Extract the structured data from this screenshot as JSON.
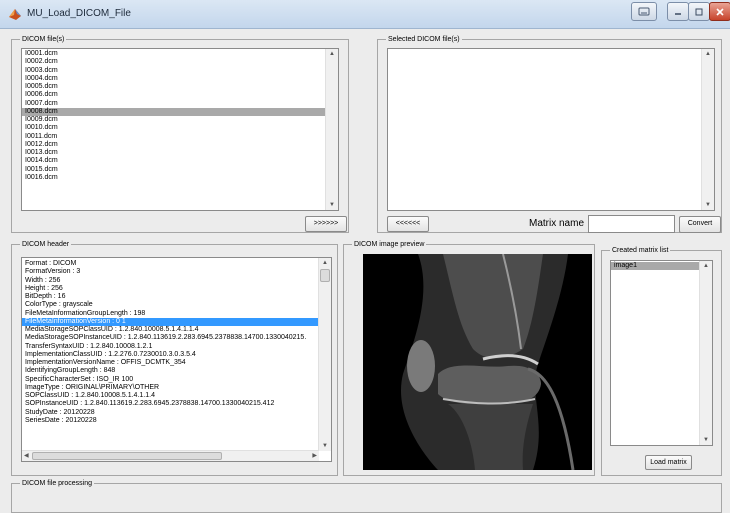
{
  "window": {
    "title": "MU_Load_DICOM_File"
  },
  "dicom_files": {
    "title": "DICOM file(s)",
    "items": [
      "I0001.dcm",
      "I0002.dcm",
      "I0003.dcm",
      "I0004.dcm",
      "I0005.dcm",
      "I0006.dcm",
      "I0007.dcm",
      "I0008.dcm",
      "I0009.dcm",
      "I0010.dcm",
      "I0011.dcm",
      "I0012.dcm",
      "I0013.dcm",
      "I0014.dcm",
      "I0015.dcm",
      "I0016.dcm"
    ],
    "selected_index": 7,
    "add_button": ">>>>>>"
  },
  "selected_files": {
    "title": "Selected DICOM file(s)",
    "remove_button": "<<<<<<",
    "matrix_name_label": "Matrix name",
    "matrix_name_value": "",
    "convert_button": "Convert"
  },
  "dicom_header": {
    "title": "DICOM header",
    "selected_index": 7,
    "lines": [
      "Format : DICOM",
      "FormatVersion : 3",
      "Width : 256",
      "Height : 256",
      "BitDepth : 16",
      "ColorType : grayscale",
      "FileMetaInformationGroupLength : 198",
      "FileMetaInformationVersion : 0  1",
      "MediaStorageSOPClassUID : 1.2.840.10008.5.1.4.1.1.4",
      "MediaStorageSOPInstanceUID : 1.2.840.113619.2.283.6945.2378838.14700.1330040215.",
      "TransferSyntaxUID : 1.2.840.10008.1.2.1",
      "ImplementationClassUID : 1.2.276.0.7230010.3.0.3.5.4",
      "ImplementationVersionName : OFFIS_DCMTK_354",
      "IdentifyingGroupLength : 848",
      "SpecificCharacterSet : ISO_IR 100",
      "ImageType : ORIGINAL\\PRIMARY\\OTHER",
      "SOPClassUID : 1.2.840.10008.5.1.4.1.1.4",
      "SOPInstanceUID : 1.2.840.113619.2.283.6945.2378838.14700.1330040215.412",
      "StudyDate : 20120228",
      "SeriesDate : 20120228"
    ]
  },
  "image_preview": {
    "title": "DICOM image preview"
  },
  "matrix_list": {
    "title": "Created matrix list",
    "items": [
      "image1"
    ],
    "load_button": "Load matrix"
  },
  "processing": {
    "title": "DICOM file processing"
  }
}
